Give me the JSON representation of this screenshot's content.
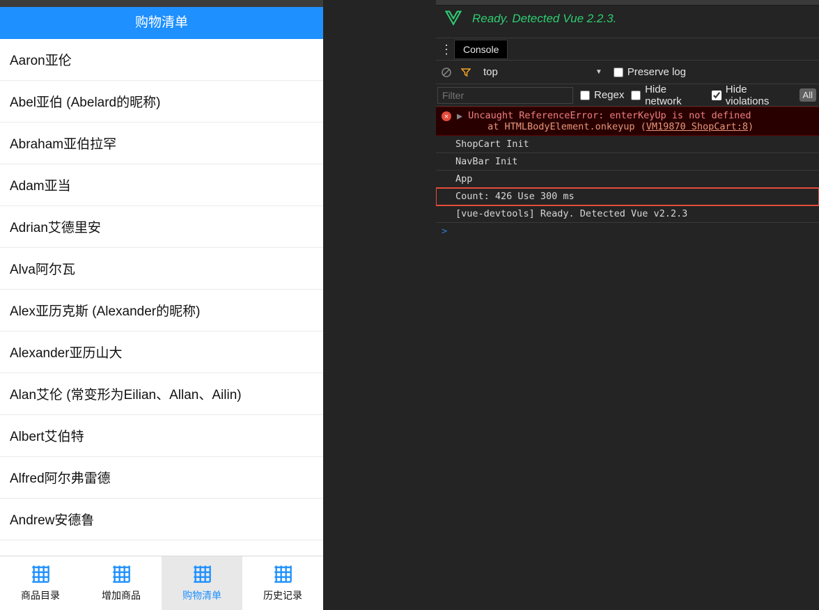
{
  "app": {
    "page_title": "购物清单",
    "list_items": [
      "Aaron亚伦",
      "Abel亚伯 (Abelard的昵称)",
      "Abraham亚伯拉罕",
      "Adam亚当",
      "Adrian艾德里安",
      "Alva阿尔瓦",
      "Alex亚历克斯 (Alexander的昵称)",
      "Alexander亚历山大",
      "Alan艾伦 (常变形为Eilian、Allan、Ailin)",
      "Albert艾伯特",
      "Alfred阿尔弗雷德",
      "Andrew安德鲁"
    ],
    "tabs": [
      {
        "label": "商品目录",
        "active": false
      },
      {
        "label": "增加商品",
        "active": false
      },
      {
        "label": "购物清单",
        "active": true
      },
      {
        "label": "历史记录",
        "active": false
      }
    ]
  },
  "devtools": {
    "vue_status": "Ready. Detected Vue 2.2.3.",
    "active_tab": "Console",
    "context": "top",
    "preserve_log_label": "Preserve log",
    "preserve_log_checked": false,
    "filter_placeholder": "Filter",
    "regex_label": "Regex",
    "regex_checked": false,
    "hide_network_label": "Hide network",
    "hide_network_checked": false,
    "hide_violations_label": "Hide violations",
    "hide_violations_checked": true,
    "levels_badge": "All",
    "error": {
      "line1": "Uncaught ReferenceError: enterKeyUp is not defined",
      "line2_prefix": "at HTMLBodyElement.onkeyup (",
      "line2_link": "VM19870 ShopCart:8",
      "line2_suffix": ")"
    },
    "logs": [
      {
        "text": "ShopCart Init",
        "highlight": false
      },
      {
        "text": "NavBar Init",
        "highlight": false
      },
      {
        "text": "App",
        "highlight": false
      },
      {
        "text": "Count: 426 Use 300 ms",
        "highlight": true
      },
      {
        "text": "[vue-devtools] Ready. Detected Vue v2.2.3",
        "highlight": false
      }
    ],
    "prompt": ">"
  }
}
